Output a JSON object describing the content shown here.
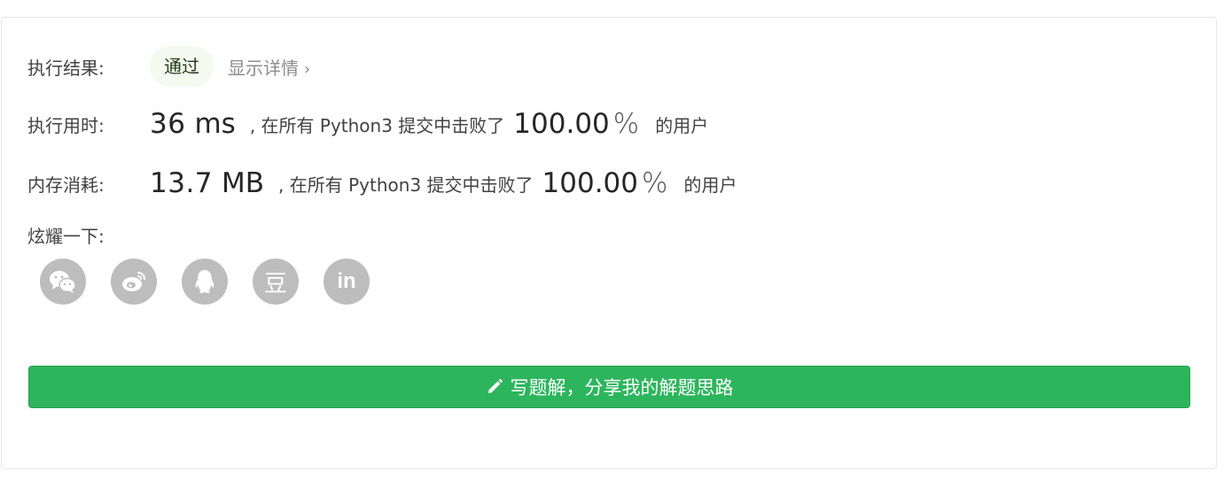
{
  "result": {
    "label": "执行结果:",
    "status": "通过",
    "details_link": "显示详情",
    "details_chevron": "›"
  },
  "runtime": {
    "label": "执行用时:",
    "value": "36",
    "unit": "ms",
    "text_before": ", 在所有 Python3 提交中击败了",
    "percent": "100.00",
    "percent_sign": "%",
    "text_after": "的用户"
  },
  "memory": {
    "label": "内存消耗:",
    "value": "13.7",
    "unit": "MB",
    "text_before": ", 在所有 Python3 提交中击败了",
    "percent": "100.00",
    "percent_sign": "%",
    "text_after": "的用户"
  },
  "share": {
    "label": "炫耀一下:",
    "icons": [
      "wechat-icon",
      "weibo-icon",
      "qq-icon",
      "douban-icon",
      "linkedin-icon"
    ],
    "douban_glyph": "豆",
    "linkedin_glyph": "in"
  },
  "write_solution": {
    "label": "写题解，分享我的解题思路",
    "icon": "pencil-icon",
    "color": "#2db55d"
  },
  "colors": {
    "badge_bg": "#f4faf0",
    "icon_gray": "#bdbdbd",
    "accent_green": "#2db55d"
  }
}
